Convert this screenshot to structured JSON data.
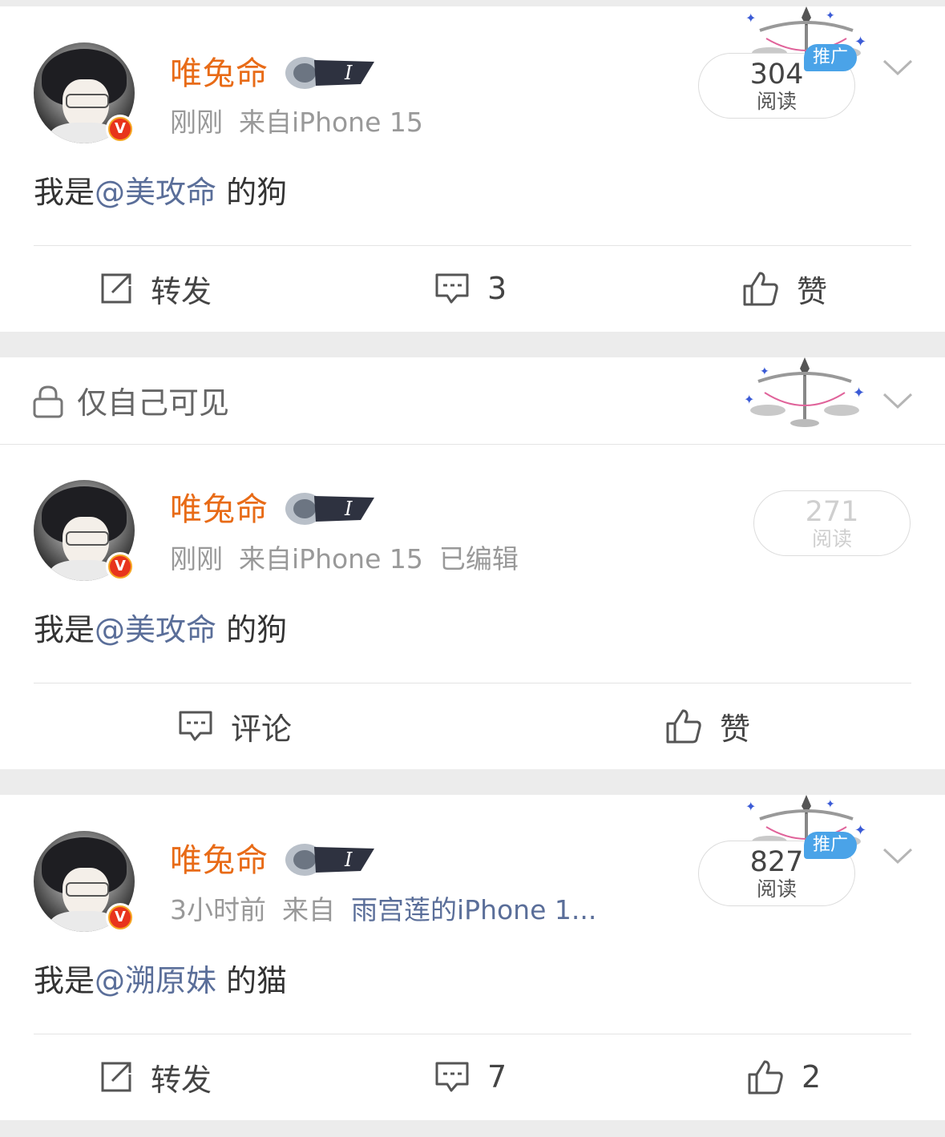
{
  "posts": [
    {
      "username": "唯兔命",
      "time": "刚刚",
      "source": "来自iPhone 15",
      "edited": "",
      "text_before": "我是",
      "mention": "@美攻命",
      "text_after": "的狗",
      "reads": "304",
      "reads_label": "阅读",
      "promo_label": "推广",
      "actions": {
        "repost": "转发",
        "comment": "3",
        "like": "赞"
      }
    },
    {
      "visibility_label": "仅自己可见",
      "username": "唯兔命",
      "time": "刚刚",
      "source": "来自iPhone 15",
      "edited": "已编辑",
      "text_before": "我是",
      "mention": "@美攻命",
      "text_after": "的狗",
      "reads": "271",
      "reads_label": "阅读",
      "actions": {
        "comment": "评论",
        "like": "赞"
      }
    },
    {
      "username": "唯兔命",
      "time": "3小时前",
      "source_prefix": "来自",
      "source_link": "雨宫莲的iPhone 1...",
      "text_before": "我是",
      "mention": "@溯原妹",
      "text_after": "的猫",
      "reads": "827",
      "reads_label": "阅读",
      "promo_label": "推广",
      "actions": {
        "repost": "转发",
        "comment": "7",
        "like": "2"
      }
    }
  ],
  "colors": {
    "username": "#e86b17",
    "mention": "#5a6e99",
    "meta": "#999999",
    "promo": "#4aa3e8",
    "verified_badge": "#e8341c"
  },
  "icons": [
    "verified-v-icon",
    "medal-badge-icon",
    "libra-scale-icon",
    "chevron-down-icon",
    "lock-icon",
    "repost-icon",
    "comment-icon",
    "like-icon"
  ]
}
